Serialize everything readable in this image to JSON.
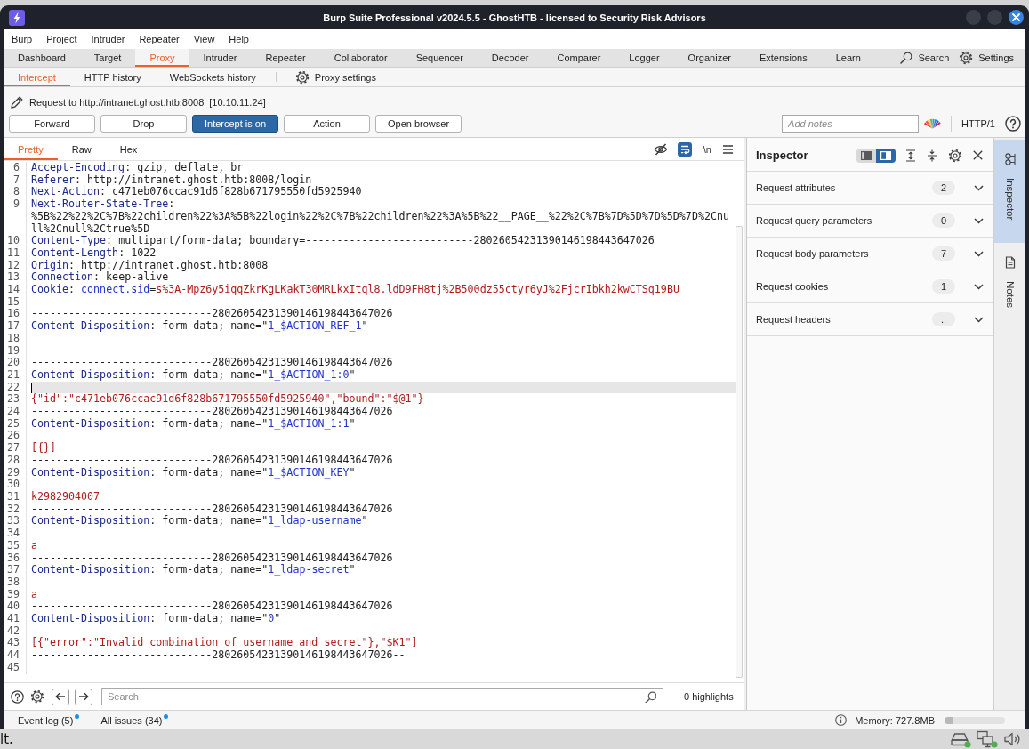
{
  "window": {
    "title": "Burp Suite Professional v2024.5.5 - GhostHTB - licensed to Security Risk Advisors"
  },
  "menu_bar": [
    "Burp",
    "Project",
    "Intruder",
    "Repeater",
    "View",
    "Help"
  ],
  "main_tabs": [
    {
      "label": "Dashboard",
      "selected": false
    },
    {
      "label": "Target",
      "selected": false
    },
    {
      "label": "Proxy",
      "selected": true
    },
    {
      "label": "Intruder",
      "selected": false
    },
    {
      "label": "Repeater",
      "selected": false
    },
    {
      "label": "Collaborator",
      "selected": false
    },
    {
      "label": "Sequencer",
      "selected": false
    },
    {
      "label": "Decoder",
      "selected": false
    },
    {
      "label": "Comparer",
      "selected": false
    },
    {
      "label": "Logger",
      "selected": false
    },
    {
      "label": "Organizer",
      "selected": false
    },
    {
      "label": "Extensions",
      "selected": false
    },
    {
      "label": "Learn",
      "selected": false
    }
  ],
  "main_tools": [
    {
      "kind": "search",
      "label": "Search"
    },
    {
      "kind": "settings",
      "label": "Settings"
    }
  ],
  "proxy_tabs": [
    {
      "label": "Intercept",
      "selected": true
    },
    {
      "label": "HTTP history",
      "selected": false
    },
    {
      "label": "WebSockets history",
      "selected": false
    }
  ],
  "proxy_settings": {
    "label": "Proxy settings"
  },
  "intercept": {
    "request_target": "Request to http://intranet.ghost.htb:8008",
    "request_ip": "[10.10.11.24]",
    "buttons": [
      {
        "label": "Forward",
        "on": false
      },
      {
        "label": "Drop",
        "on": false
      },
      {
        "label": "Intercept is on",
        "on": true
      },
      {
        "label": "Action",
        "on": false
      },
      {
        "label": "Open browser",
        "on": false
      }
    ],
    "notes": {
      "placeholder": "Add notes"
    },
    "protocol": "HTTP/1"
  },
  "editor": {
    "tabs": [
      {
        "label": "Pretty",
        "selected": true
      },
      {
        "label": "Raw",
        "selected": false
      },
      {
        "label": "Hex",
        "selected": false
      }
    ],
    "tools": [
      {
        "kind": "hide",
        "on": false
      },
      {
        "kind": "wrap",
        "on": true
      },
      {
        "kind": "newlines",
        "label": "\\n",
        "on": false
      },
      {
        "kind": "menu"
      }
    ],
    "lines": [
      {
        "number": "6",
        "current": false,
        "parts": [
          {
            "kind": "name",
            "text": "Accept-Encoding"
          },
          {
            "kind": "text",
            "text": ": gzip, deflate, br"
          }
        ]
      },
      {
        "number": "7",
        "current": false,
        "parts": [
          {
            "kind": "name",
            "text": "Referer"
          },
          {
            "kind": "text",
            "text": ": http://intranet.ghost.htb:8008/login"
          }
        ]
      },
      {
        "number": "8",
        "current": false,
        "parts": [
          {
            "kind": "name",
            "text": "Next-Action"
          },
          {
            "kind": "text",
            "text": ": c471eb076ccac91d6f828b671795550fd5925940"
          }
        ]
      },
      {
        "number": "9",
        "current": false,
        "parts": [
          {
            "kind": "name",
            "text": "Next-Router-State-Tree"
          },
          {
            "kind": "text",
            "text": ": %5B%22%22%2C%7B%22children%22%3A%5B%22login%22%2C%7B%22children%22%3A%5B%22__PAGE__%22%2C%7B%7D%5D%7D%5D%7D%2Cnull%2Cnull%2Ctrue%5D"
          }
        ]
      },
      {
        "number": "10",
        "current": false,
        "parts": [
          {
            "kind": "name",
            "text": "Content-Type"
          },
          {
            "kind": "text",
            "text": ": multipart/form-data; boundary=---------------------------28026054231390146198443647026"
          }
        ]
      },
      {
        "number": "11",
        "current": false,
        "parts": [
          {
            "kind": "name",
            "text": "Content-Length"
          },
          {
            "kind": "text",
            "text": ": 1022"
          }
        ]
      },
      {
        "number": "12",
        "current": false,
        "parts": [
          {
            "kind": "name",
            "text": "Origin"
          },
          {
            "kind": "text",
            "text": ": http://intranet.ghost.htb:8008"
          }
        ]
      },
      {
        "number": "13",
        "current": false,
        "parts": [
          {
            "kind": "name",
            "text": "Connection"
          },
          {
            "kind": "text",
            "text": ": keep-alive"
          }
        ]
      },
      {
        "number": "14",
        "current": false,
        "parts": [
          {
            "kind": "name",
            "text": "Cookie"
          },
          {
            "kind": "text",
            "text": ": "
          },
          {
            "kind": "attr",
            "text": "connect.sid"
          },
          {
            "kind": "text",
            "text": "="
          },
          {
            "kind": "value",
            "text": "s%3A-Mpz6y5iqqZkrKgLKakT30MRLkxItql8.ldD9FH8tj%2B500dz55ctyr6yJ%2FjcrIbkh2kwCTSq19BU"
          }
        ]
      },
      {
        "number": "15",
        "current": false
      },
      {
        "number": "16",
        "current": false,
        "parts": [
          {
            "kind": "text",
            "text": "-----------------------------28026054231390146198443647026"
          }
        ]
      },
      {
        "number": "17",
        "current": false,
        "parts": [
          {
            "kind": "name",
            "text": "Content-Disposition"
          },
          {
            "kind": "text",
            "text": ": form-data; name=\""
          },
          {
            "kind": "attr",
            "text": "1_$ACTION_REF_1"
          },
          {
            "kind": "text",
            "text": "\""
          }
        ]
      },
      {
        "number": "18",
        "current": false
      },
      {
        "number": "19",
        "current": false
      },
      {
        "number": "20",
        "current": false,
        "parts": [
          {
            "kind": "text",
            "text": "-----------------------------28026054231390146198443647026"
          }
        ]
      },
      {
        "number": "21",
        "current": false,
        "parts": [
          {
            "kind": "name",
            "text": "Content-Disposition"
          },
          {
            "kind": "text",
            "text": ": form-data; name=\""
          },
          {
            "kind": "attr",
            "text": "1_$ACTION_1:0"
          },
          {
            "kind": "text",
            "text": "\""
          }
        ]
      },
      {
        "number": "22",
        "current": true
      },
      {
        "number": "23",
        "current": false,
        "parts": [
          {
            "kind": "value",
            "text": "{\"id\":\"c471eb076ccac91d6f828b671795550fd5925940\",\"bound\":\"$@1\"}"
          }
        ]
      },
      {
        "number": "24",
        "current": false,
        "parts": [
          {
            "kind": "text",
            "text": "-----------------------------28026054231390146198443647026"
          }
        ]
      },
      {
        "number": "25",
        "current": false,
        "parts": [
          {
            "kind": "name",
            "text": "Content-Disposition"
          },
          {
            "kind": "text",
            "text": ": form-data; name=\""
          },
          {
            "kind": "attr",
            "text": "1_$ACTION_1:1"
          },
          {
            "kind": "text",
            "text": "\""
          }
        ]
      },
      {
        "number": "26",
        "current": false
      },
      {
        "number": "27",
        "current": false,
        "parts": [
          {
            "kind": "value",
            "text": "[{}]"
          }
        ]
      },
      {
        "number": "28",
        "current": false,
        "parts": [
          {
            "kind": "text",
            "text": "-----------------------------28026054231390146198443647026"
          }
        ]
      },
      {
        "number": "29",
        "current": false,
        "parts": [
          {
            "kind": "name",
            "text": "Content-Disposition"
          },
          {
            "kind": "text",
            "text": ": form-data; name=\""
          },
          {
            "kind": "attr",
            "text": "1_$ACTION_KEY"
          },
          {
            "kind": "text",
            "text": "\""
          }
        ]
      },
      {
        "number": "30",
        "current": false
      },
      {
        "number": "31",
        "current": false,
        "parts": [
          {
            "kind": "value",
            "text": "k2982904007"
          }
        ]
      },
      {
        "number": "32",
        "current": false,
        "parts": [
          {
            "kind": "text",
            "text": "-----------------------------28026054231390146198443647026"
          }
        ]
      },
      {
        "number": "33",
        "current": false,
        "parts": [
          {
            "kind": "name",
            "text": "Content-Disposition"
          },
          {
            "kind": "text",
            "text": ": form-data; name=\""
          },
          {
            "kind": "attr",
            "text": "1_ldap-username"
          },
          {
            "kind": "text",
            "text": "\""
          }
        ]
      },
      {
        "number": "34",
        "current": false
      },
      {
        "number": "35",
        "current": false,
        "parts": [
          {
            "kind": "value",
            "text": "a"
          }
        ]
      },
      {
        "number": "36",
        "current": false,
        "parts": [
          {
            "kind": "text",
            "text": "-----------------------------28026054231390146198443647026"
          }
        ]
      },
      {
        "number": "37",
        "current": false,
        "parts": [
          {
            "kind": "name",
            "text": "Content-Disposition"
          },
          {
            "kind": "text",
            "text": ": form-data; name=\""
          },
          {
            "kind": "attr",
            "text": "1_ldap-secret"
          },
          {
            "kind": "text",
            "text": "\""
          }
        ]
      },
      {
        "number": "38",
        "current": false
      },
      {
        "number": "39",
        "current": false,
        "parts": [
          {
            "kind": "value",
            "text": "a"
          }
        ]
      },
      {
        "number": "40",
        "current": false,
        "parts": [
          {
            "kind": "text",
            "text": "-----------------------------28026054231390146198443647026"
          }
        ]
      },
      {
        "number": "41",
        "current": false,
        "parts": [
          {
            "kind": "name",
            "text": "Content-Disposition"
          },
          {
            "kind": "text",
            "text": ": form-data; name=\""
          },
          {
            "kind": "attr",
            "text": "0"
          },
          {
            "kind": "text",
            "text": "\""
          }
        ]
      },
      {
        "number": "42",
        "current": false
      },
      {
        "number": "43",
        "current": false,
        "parts": [
          {
            "kind": "value",
            "text": "[{\"error\":\"Invalid combination of username and secret\"},\"$K1\"]"
          }
        ]
      },
      {
        "number": "44",
        "current": false,
        "parts": [
          {
            "kind": "text",
            "text": "-----------------------------28026054231390146198443647026--"
          }
        ]
      },
      {
        "number": "45",
        "current": false
      }
    ],
    "search": {
      "placeholder": "Search"
    },
    "highlights": "0 highlights"
  },
  "inspector": {
    "title": "Inspector",
    "layouts": [
      {
        "kind": "left",
        "selected": false
      },
      {
        "kind": "right",
        "selected": true
      }
    ],
    "sections": [
      {
        "label": "Request attributes",
        "count": "2",
        "expanded": false
      },
      {
        "label": "Request query parameters",
        "count": "0",
        "expanded": false
      },
      {
        "label": "Request body parameters",
        "count": "7",
        "expanded": false
      },
      {
        "label": "Request cookies",
        "count": "1",
        "expanded": false
      },
      {
        "label": "Request headers",
        "count": "..",
        "expanded": false
      }
    ]
  },
  "side_tabs": [
    {
      "kind": "inspector",
      "label": "Inspector",
      "selected": true
    },
    {
      "kind": "notes",
      "label": "Notes",
      "selected": false
    }
  ],
  "status_bar": {
    "items": [
      {
        "label": "Event log (5)",
        "unread": true
      },
      {
        "label": "All issues (34)",
        "unread": true
      }
    ],
    "memory": {
      "label": "Memory: 727.8MB",
      "level": 0.15
    }
  },
  "taskbar": {
    "text": "lt."
  }
}
